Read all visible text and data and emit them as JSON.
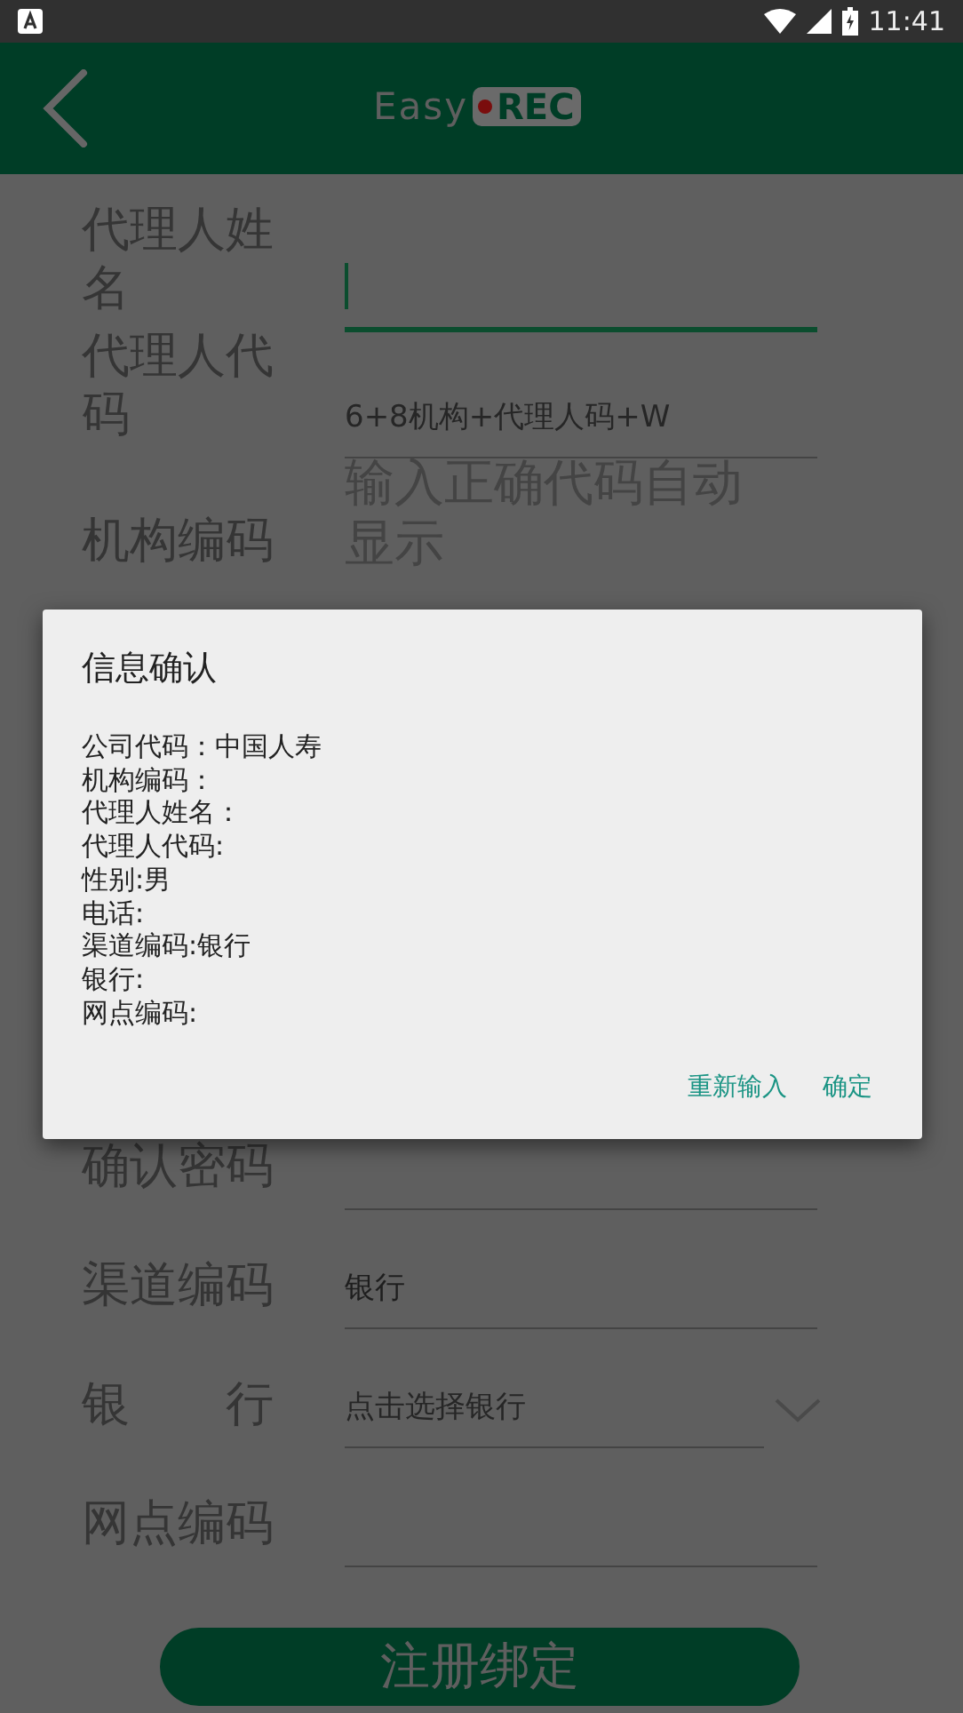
{
  "status_bar": {
    "time": "11:41"
  },
  "app_bar": {
    "logo_left": "Easy",
    "logo_right": "REC"
  },
  "form": {
    "fields": [
      {
        "kind": "input",
        "label": "代理人姓名",
        "focused": true
      },
      {
        "kind": "input",
        "label": "代理人代码",
        "placeholder": "6+8机构+代理人码+W",
        "focused": false
      },
      {
        "kind": "display",
        "label": "机构编码",
        "placeholder": "输入正确代码自动显示"
      }
    ],
    "fields_below_dialog": [
      {
        "kind": "input",
        "label": "确认密码",
        "focused": false
      },
      {
        "kind": "input",
        "label": "渠道编码",
        "value": "银行",
        "focused": false
      },
      {
        "kind": "select",
        "label": "银 行",
        "placeholder": "点击选择银行"
      },
      {
        "kind": "input",
        "label": "网点编码",
        "focused": false
      }
    ],
    "submit": "注册绑定"
  },
  "dialog": {
    "title": "信息确认",
    "lines": [
      "公司代码：中国人寿",
      "机构编码：",
      "代理人姓名：",
      "代理人代码:",
      "性别:男",
      "电话:",
      "渠道编码:银行",
      "银行:",
      "网点编码:"
    ],
    "buttons": [
      "重新输入",
      "确定"
    ]
  }
}
